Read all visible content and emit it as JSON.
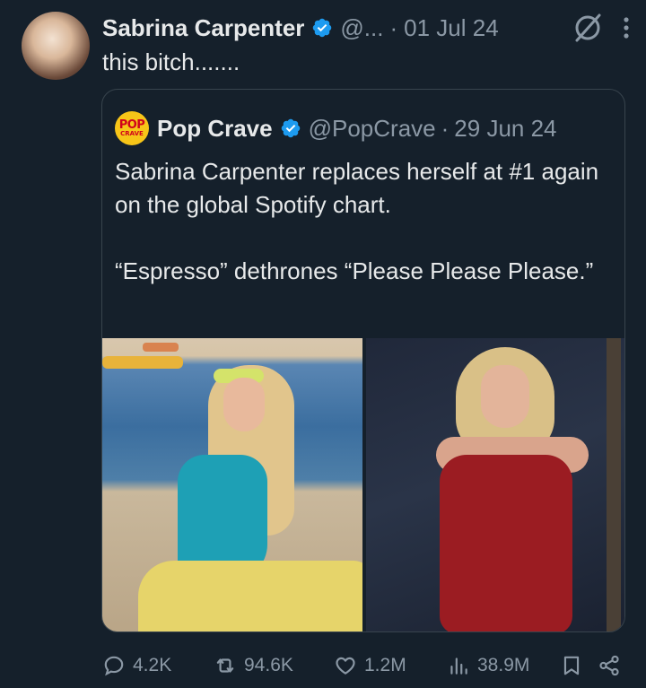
{
  "tweet": {
    "author_name": "Sabrina Carpenter",
    "handle": "@...",
    "separator": "·",
    "date": "01 Jul 24",
    "text": "this bitch......."
  },
  "quote": {
    "logo_top": "POP",
    "logo_bottom": "CRAVE",
    "author_name": "Pop Crave",
    "handle": "@PopCrave",
    "separator": "·",
    "date": "29 Jun 24",
    "text_line1": "Sabrina Carpenter replaces herself at #1 again on the global Spotify chart.",
    "text_line2": "“Espresso” dethrones “Please Please Please.”"
  },
  "actions": {
    "replies": "4.2K",
    "reposts": "94.6K",
    "likes": "1.2M",
    "views": "38.9M"
  },
  "colors": {
    "background": "#15202b",
    "text": "#e7e9ea",
    "muted": "#8b98a5",
    "border": "#38444d",
    "verified": "#1d9bf0"
  },
  "icons": [
    "verified-badge-icon",
    "grok-icon",
    "more-icon",
    "reply-icon",
    "repost-icon",
    "like-icon",
    "views-icon",
    "bookmark-icon",
    "share-icon"
  ]
}
